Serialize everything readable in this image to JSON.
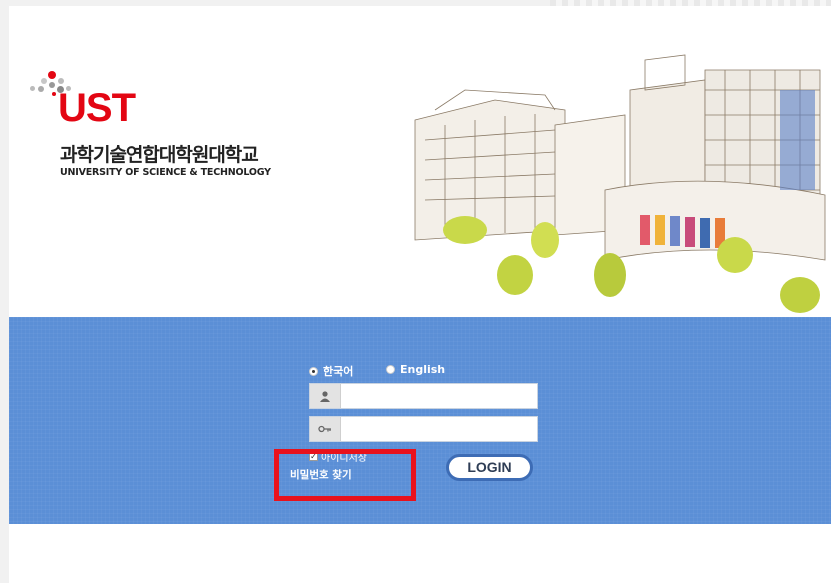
{
  "brand": {
    "logo_text": "UST",
    "korean_name": "과학기술연합대학원대학교",
    "english_name": "UNIVERSITY OF SCIENCE & TECHNOLOGY",
    "accent_color": "#e30613"
  },
  "login": {
    "languages": [
      {
        "label": "한국어",
        "selected": true
      },
      {
        "label": "English",
        "selected": false
      }
    ],
    "user_icon": "user-icon",
    "key_icon": "key-icon",
    "save_id_label": "아이디저장",
    "find_password_label": "비밀번호 찾기",
    "login_button_label": "LOGIN",
    "panel_color": "#5b8fd6"
  }
}
